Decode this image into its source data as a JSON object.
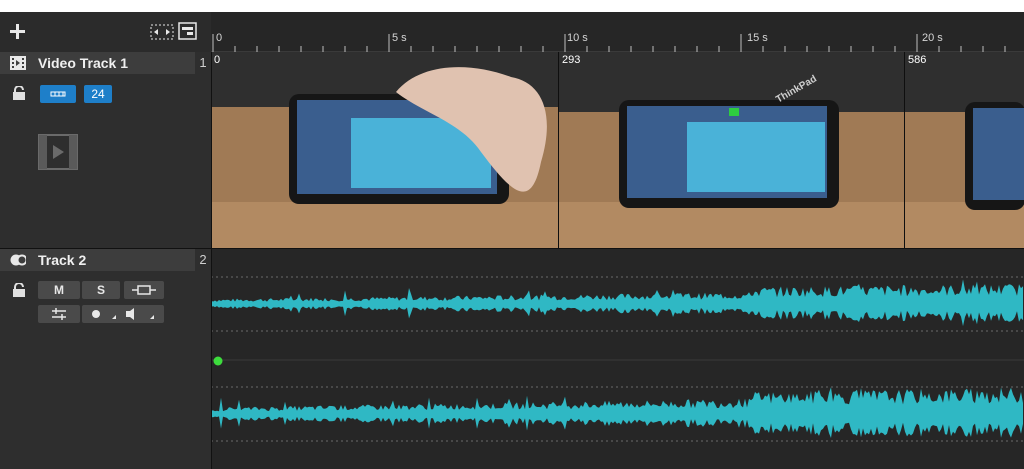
{
  "toolbar": {
    "add_icon": "plus-icon",
    "fit_icon": "fit-view-icon",
    "panel_icon": "panel-icon"
  },
  "ruler": {
    "ticks": [
      "0",
      "5 s",
      "10 s",
      "15 s",
      "20 s"
    ]
  },
  "tracks": [
    {
      "name": "Video Track 1",
      "number": "1",
      "type": "video",
      "buttons": [
        {
          "label": ""
        },
        {
          "label": "24"
        }
      ],
      "thumbnails": [
        {
          "frame": "0"
        },
        {
          "frame": "293"
        },
        {
          "frame": "586"
        }
      ],
      "overlay_text": "ThinkPad"
    },
    {
      "name": "Track 2",
      "number": "2",
      "type": "audio",
      "mute_label": "M",
      "solo_label": "S"
    }
  ],
  "colors": {
    "accent": "#1e7fc9",
    "waveform": "#2fb8c4",
    "playhead": "#3ddc3d",
    "background": "#1f1f1f"
  }
}
